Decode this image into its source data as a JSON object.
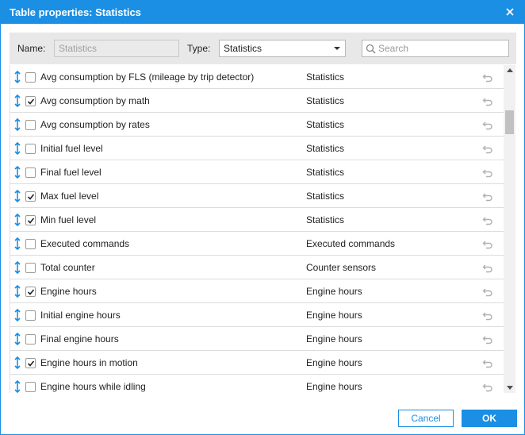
{
  "dialog": {
    "title": "Table properties: Statistics"
  },
  "filter": {
    "name_label": "Name:",
    "name_value": "Statistics",
    "type_label": "Type:",
    "type_value": "Statistics",
    "search_placeholder": "Search"
  },
  "rows": [
    {
      "name": "Avg consumption by FLS (mileage by trip detector)",
      "type": "Statistics",
      "checked": false
    },
    {
      "name": "Avg consumption by math",
      "type": "Statistics",
      "checked": true
    },
    {
      "name": "Avg consumption by rates",
      "type": "Statistics",
      "checked": false
    },
    {
      "name": "Initial fuel level",
      "type": "Statistics",
      "checked": false
    },
    {
      "name": "Final fuel level",
      "type": "Statistics",
      "checked": false
    },
    {
      "name": "Max fuel level",
      "type": "Statistics",
      "checked": true
    },
    {
      "name": "Min fuel level",
      "type": "Statistics",
      "checked": true
    },
    {
      "name": "Executed commands",
      "type": "Executed commands",
      "checked": false
    },
    {
      "name": "Total counter",
      "type": "Counter sensors",
      "checked": false
    },
    {
      "name": "Engine hours",
      "type": "Engine hours",
      "checked": true
    },
    {
      "name": "Initial engine hours",
      "type": "Engine hours",
      "checked": false
    },
    {
      "name": "Final engine hours",
      "type": "Engine hours",
      "checked": false
    },
    {
      "name": "Engine hours in motion",
      "type": "Engine hours",
      "checked": true
    },
    {
      "name": "Engine hours while idling",
      "type": "Engine hours",
      "checked": false
    }
  ],
  "footer": {
    "cancel_label": "Cancel",
    "ok_label": "OK"
  },
  "colors": {
    "accent": "#1a8fe3",
    "drag_icon": "#1a8fe3",
    "reset_icon": "#b0b0b0"
  },
  "icons": {
    "close": "close-icon",
    "search": "search-icon",
    "drag": "drag-handle-icon",
    "reset": "reset-icon",
    "dropdown": "chevron-down-icon"
  }
}
